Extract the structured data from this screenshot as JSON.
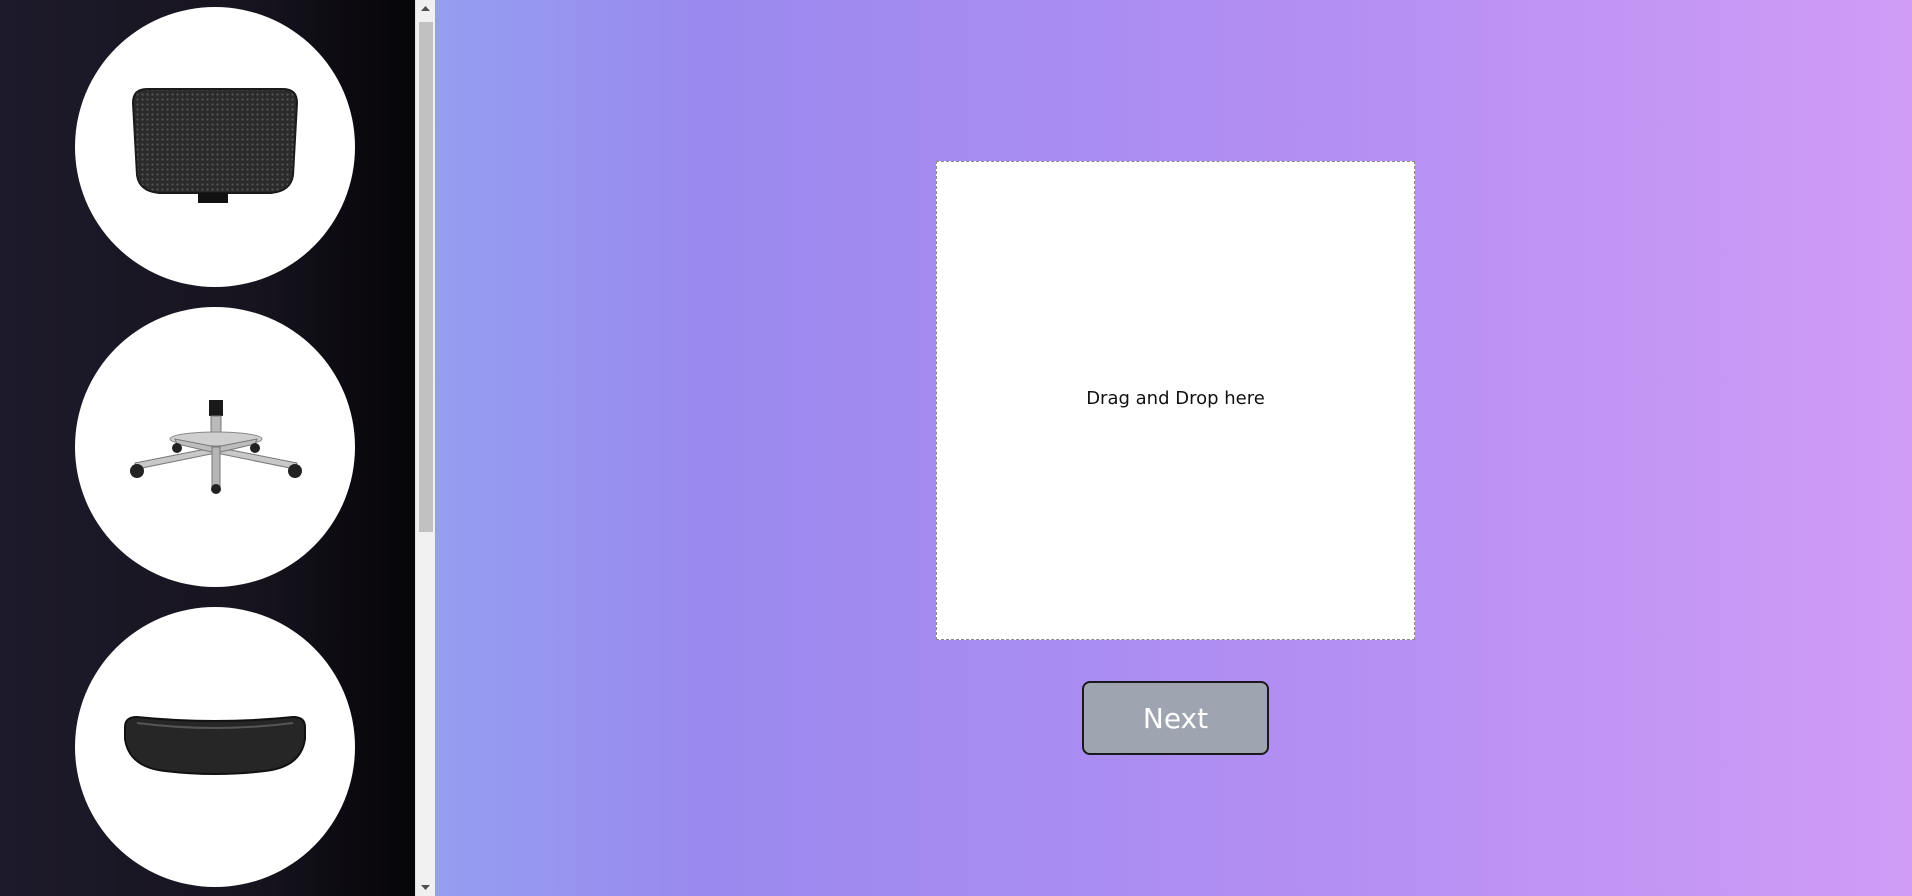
{
  "sidebar": {
    "parts": [
      {
        "icon": "chair-headrest-icon"
      },
      {
        "icon": "chair-base-icon"
      },
      {
        "icon": "chair-armrest-pad-icon"
      }
    ]
  },
  "dropzone": {
    "label": "Drag and Drop here"
  },
  "actions": {
    "next_label": "Next"
  },
  "colors": {
    "background_gradient": [
      "#8cc0f1",
      "#9a89ef",
      "#b48ff3",
      "#d09cf6"
    ],
    "sidebar_bg": "#17141f",
    "next_button_bg": "#9ea5b1"
  }
}
